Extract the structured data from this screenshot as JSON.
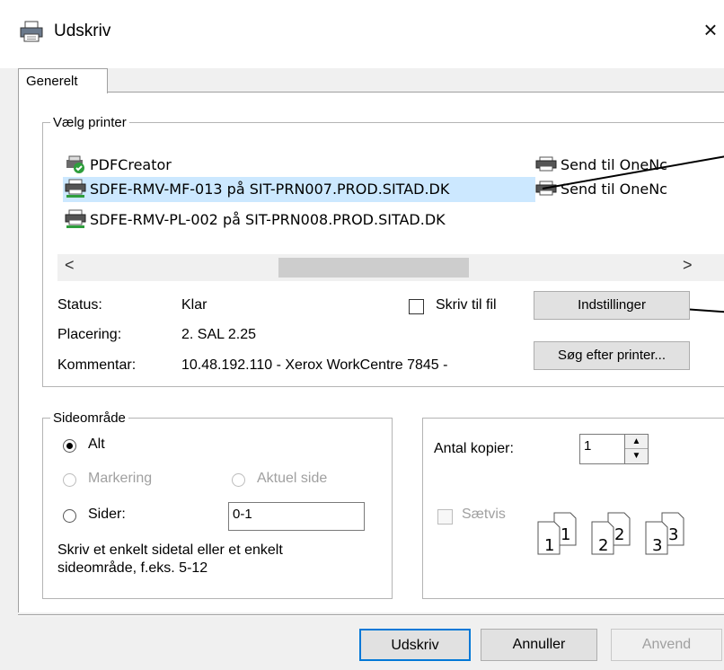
{
  "window": {
    "title": "Udskriv",
    "close": "×"
  },
  "tabs": [
    {
      "label": "Generelt"
    }
  ],
  "printer_group": {
    "legend": "Vælg printer",
    "printers": [
      {
        "name": "PDFCreator",
        "icon": "pdf-printer-icon"
      },
      {
        "name": "SDFE-RMV-MF-013 på SIT-PRN007.PROD.SITAD.DK",
        "icon": "network-printer-icon",
        "selected": true
      },
      {
        "name": "SDFE-RMV-PL-002 på SIT-PRN008.PROD.SITAD.DK",
        "icon": "network-printer-icon"
      },
      {
        "name": "Send til OneNc",
        "icon": "printer-icon"
      },
      {
        "name": "Send til OneNc",
        "icon": "printer-icon"
      }
    ],
    "scroll_left": "<",
    "scroll_right": ">",
    "status_label": "Status:",
    "status_value": "Klar",
    "location_label": "Placering:",
    "location_value": "2. SAL 2.25",
    "comment_label": "Kommentar:",
    "comment_value": "10.48.192.110 - Xerox WorkCentre 7845 -",
    "print_to_file": "Skriv til fil",
    "settings_button": "Indstillinger",
    "find_printer_button": "Søg efter printer..."
  },
  "range_group": {
    "legend": "Sideområde",
    "all": "Alt",
    "selection": "Markering",
    "current_page": "Aktuel side",
    "pages": "Sider:",
    "pages_value": "0-1",
    "hint": "Skriv et enkelt sidetal eller et enkelt sideområde, f.eks. 5-12"
  },
  "copies_group": {
    "label": "Antal kopier:",
    "value": "1",
    "collate": "Sætvis",
    "collate_digits": [
      "1",
      "1",
      "2",
      "2",
      "3",
      "3"
    ]
  },
  "footer": {
    "print": "Udskriv",
    "cancel": "Annuller",
    "apply": "Anvend"
  },
  "colors": {
    "selection": "#cce8ff",
    "default_button_border": "#0078d7"
  }
}
